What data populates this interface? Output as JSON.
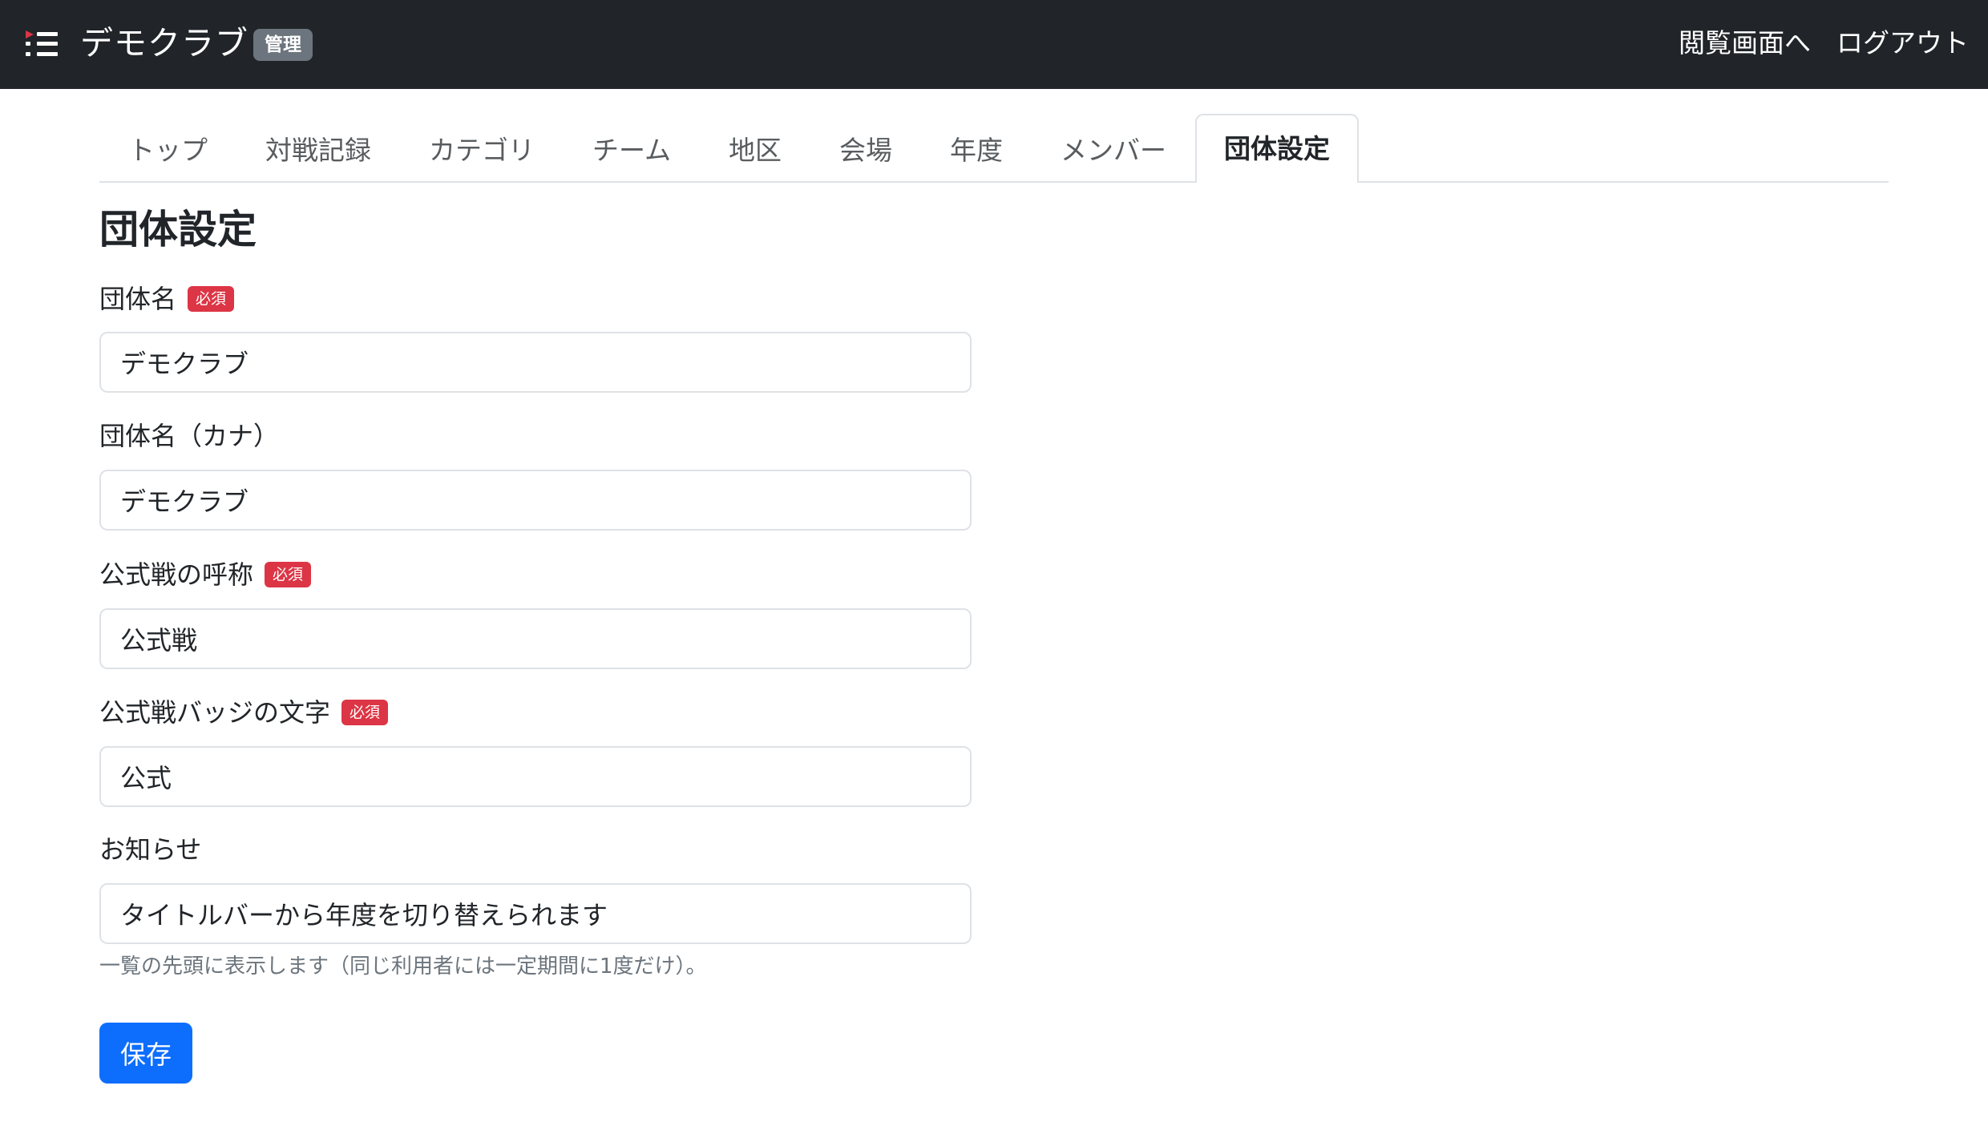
{
  "header": {
    "brand": "デモクラブ",
    "badge": "管理",
    "links": [
      "閲覧画面へ",
      "ログアウト"
    ]
  },
  "tabs": [
    {
      "label": "トップ",
      "active": false
    },
    {
      "label": "対戦記録",
      "active": false
    },
    {
      "label": "カテゴリ",
      "active": false
    },
    {
      "label": "チーム",
      "active": false
    },
    {
      "label": "地区",
      "active": false
    },
    {
      "label": "会場",
      "active": false
    },
    {
      "label": "年度",
      "active": false
    },
    {
      "label": "メンバー",
      "active": false
    },
    {
      "label": "団体設定",
      "active": true
    }
  ],
  "page_title": "団体設定",
  "required_badge": "必須",
  "form": {
    "org_name": {
      "label": "団体名",
      "value": "デモクラブ"
    },
    "org_name_kana": {
      "label": "団体名（カナ）",
      "value": "デモクラブ"
    },
    "official_name": {
      "label": "公式戦の呼称",
      "value": "公式戦"
    },
    "official_badge": {
      "label": "公式戦バッジの文字",
      "value": "公式"
    },
    "notice": {
      "label": "お知らせ",
      "value": "タイトルバーから年度を切り替えられます",
      "help": "一覧の先頭に表示します（同じ利用者には一定期間に1度だけ）。"
    }
  },
  "save_label": "保存",
  "colors": {
    "navbar": "#212529",
    "primary": "#0d6efd",
    "danger": "#dc3545",
    "secondary": "#6c757d"
  }
}
